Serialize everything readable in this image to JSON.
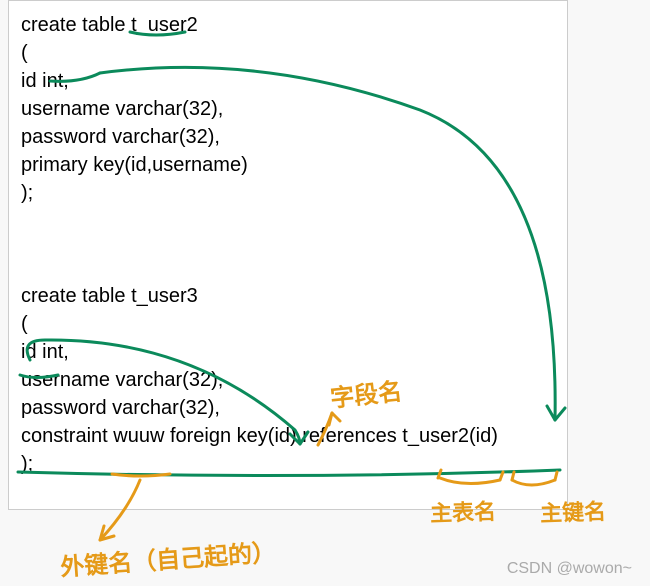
{
  "code_block_1": {
    "l1": "create table t_user2",
    "l2": "(",
    "l3": "id int,",
    "l4": "username varchar(32),",
    "l5": "password varchar(32),",
    "l6": "primary key(id,username)",
    "l7": ");"
  },
  "code_block_2": {
    "l1": "create table t_user3",
    "l2": "(",
    "l3": "id int,",
    "l4": "username varchar(32),",
    "l5": "password varchar(32),",
    "l6": "constraint wuuw foreign key(id) references t_user2(id)",
    "l7": ");"
  },
  "annotations": {
    "field_name": "字段名",
    "foreign_key_name": "外键名（自己起的）",
    "main_table_name": "主表名",
    "main_key_name": "主键名"
  },
  "watermark": "CSDN @wowon~",
  "colors": {
    "green": "#0b8a5b",
    "orange": "#e59a18"
  }
}
